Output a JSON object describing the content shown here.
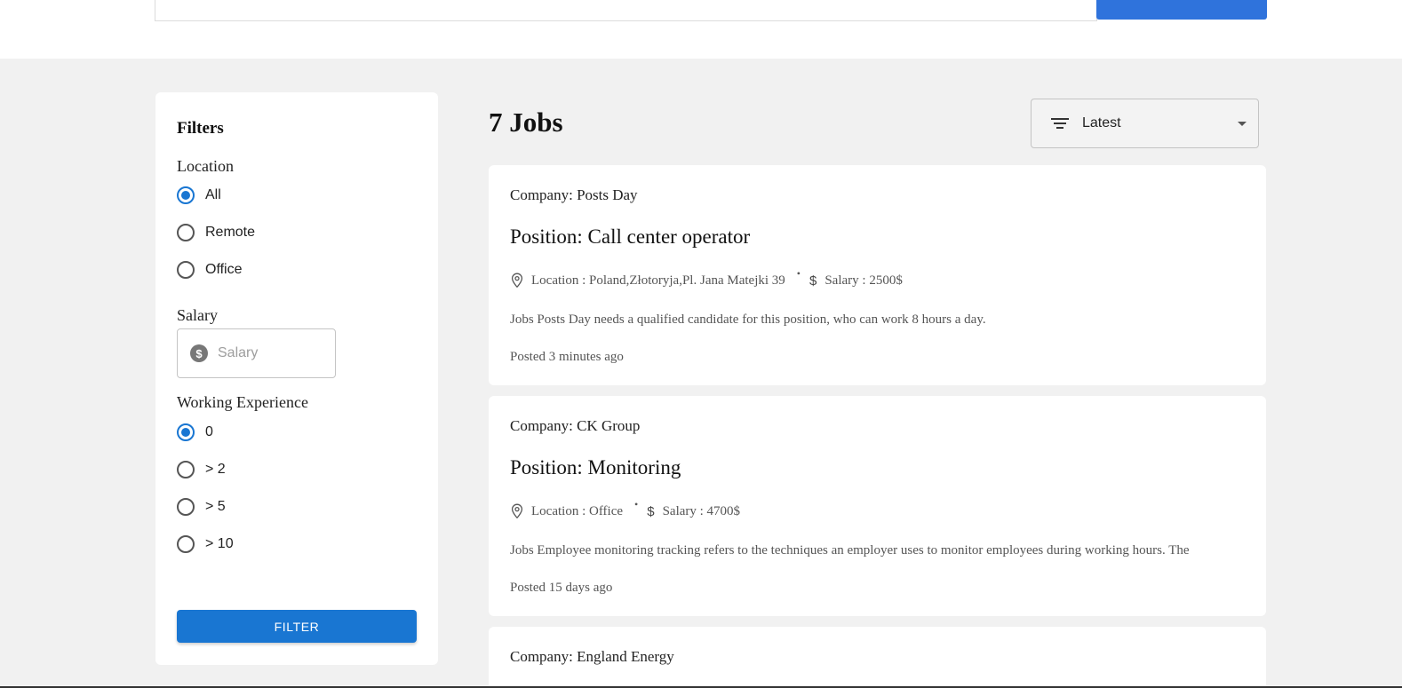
{
  "filters": {
    "title": "Filters",
    "location": {
      "label": "Location",
      "options": [
        "All",
        "Remote",
        "Office"
      ],
      "selected": "All"
    },
    "salary": {
      "label": "Salary",
      "placeholder": "Salary",
      "value": ""
    },
    "experience": {
      "label": "Working Experience",
      "options": [
        "0",
        "> 2",
        "> 5",
        "> 10"
      ],
      "selected": "0"
    },
    "button_label": "FILTER"
  },
  "results": {
    "count_label": "7 Jobs",
    "sort": {
      "selected": "Latest",
      "icon": "sort-icon"
    }
  },
  "jobs": [
    {
      "company": "Company: Posts Day",
      "position": "Position: Call center operator",
      "location": "Location : Poland,Złotoryja,Pl. Jana Matejki 39",
      "salary": "Salary : 2500$",
      "description": "Jobs Posts Day needs a qualified candidate for this position, who can work 8 hours a day.",
      "posted": "Posted 3 minutes ago"
    },
    {
      "company": "Company: CK Group",
      "position": "Position: Monitoring",
      "location": "Location : Office",
      "salary": "Salary : 4700$",
      "description": "Jobs Employee monitoring tracking refers to the techniques an employer uses to monitor employees during working hours. The",
      "posted": "Posted 15 days ago"
    },
    {
      "company": "Company: England Energy"
    }
  ],
  "colors": {
    "primary": "#1976d2",
    "page_background": "#f1f1f1",
    "card_background": "#ffffff"
  }
}
